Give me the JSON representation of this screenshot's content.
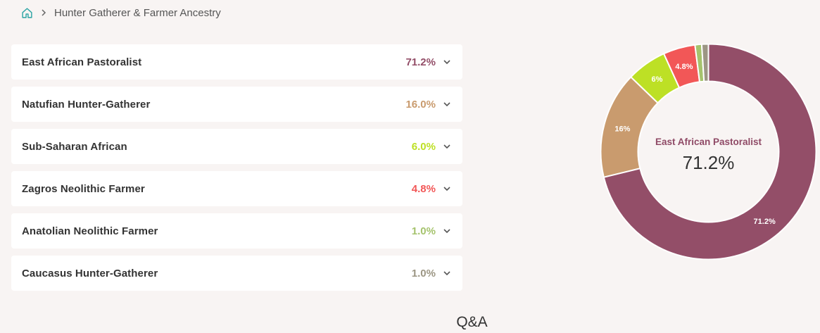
{
  "breadcrumb": {
    "home_icon": "home-icon",
    "separator_icon": "chevron-right-icon",
    "current": "Hunter Gatherer & Farmer Ancestry"
  },
  "ancestry": [
    {
      "name": "East African Pastoralist",
      "percent": "71.2%",
      "color": "#934e68"
    },
    {
      "name": "Natufian Hunter-Gatherer",
      "percent": "16.0%",
      "color": "#c99b6e"
    },
    {
      "name": "Sub-Saharan African",
      "percent": "6.0%",
      "color": "#bde025"
    },
    {
      "name": "Zagros Neolithic Farmer",
      "percent": "4.8%",
      "color": "#f25757"
    },
    {
      "name": "Anatolian Neolithic Farmer",
      "percent": "1.0%",
      "color": "#a5c36d"
    },
    {
      "name": "Caucasus Hunter-Gatherer",
      "percent": "1.0%",
      "color": "#9c9684"
    }
  ],
  "expand_icon": "chevron-down-icon",
  "chart_data": {
    "type": "pie",
    "style": "donut",
    "categories": [
      "East African Pastoralist",
      "Natufian Hunter-Gatherer",
      "Sub-Saharan African",
      "Zagros Neolithic Farmer",
      "Anatolian Neolithic Farmer",
      "Caucasus Hunter-Gatherer"
    ],
    "values": [
      71.2,
      16.0,
      6.0,
      4.8,
      1.0,
      1.0
    ],
    "slice_labels": [
      "71.2%",
      "16%",
      "6%",
      "4.8%",
      "",
      ""
    ],
    "colors": [
      "#934e68",
      "#c99b6e",
      "#bde025",
      "#f25757",
      "#a5c36d",
      "#9c9684"
    ],
    "center_label": "East African Pastoralist",
    "center_value": "71.2%"
  },
  "footer": {
    "qa_heading": "Q&A"
  }
}
